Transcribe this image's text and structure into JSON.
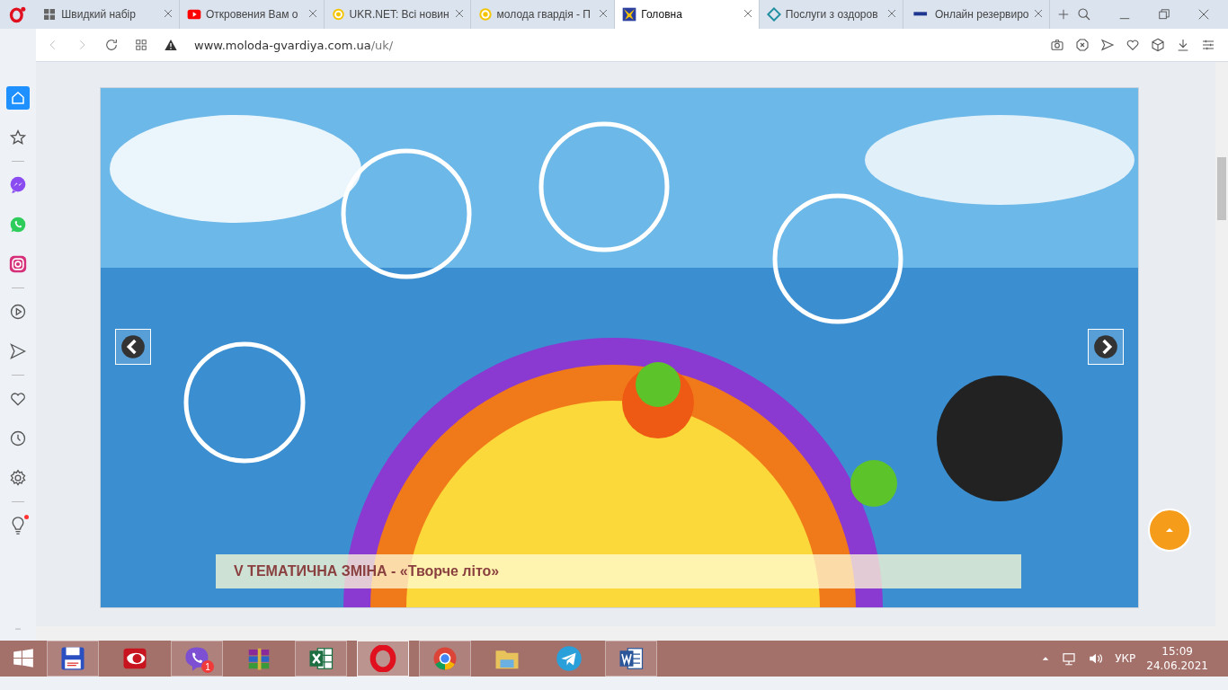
{
  "tabs": [
    {
      "label": "Швидкий набір",
      "kind": "grid",
      "selected": false
    },
    {
      "label": "Откровения Вам о",
      "kind": "video",
      "selected": false
    },
    {
      "label": "UKR.NET: Всі новин",
      "kind": "coin",
      "selected": false
    },
    {
      "label": "молода гвардія - П",
      "kind": "coin",
      "selected": false
    },
    {
      "label": "Головна",
      "kind": "star",
      "selected": true
    },
    {
      "label": "Послуги з оздоров",
      "kind": "diamond",
      "selected": false
    },
    {
      "label": "Онлайн резервиро",
      "kind": "rail",
      "selected": false
    }
  ],
  "address_bar": {
    "host": "www.moloda-gvardiya.com.ua",
    "path": "/uk/"
  },
  "sidebar": {
    "items": [
      {
        "kind": "home",
        "selected": true,
        "notify": false
      },
      {
        "kind": "star",
        "selected": false,
        "notify": false
      },
      {
        "kind": "sep"
      },
      {
        "kind": "messenger",
        "selected": false,
        "notify": false
      },
      {
        "kind": "whatsapp",
        "selected": false,
        "notify": false
      },
      {
        "kind": "instagram",
        "selected": false,
        "notify": false
      },
      {
        "kind": "sep"
      },
      {
        "kind": "player",
        "selected": false,
        "notify": false
      },
      {
        "kind": "send",
        "selected": false,
        "notify": false
      },
      {
        "kind": "sep"
      },
      {
        "kind": "heart",
        "selected": false,
        "notify": false
      },
      {
        "kind": "clock",
        "selected": false,
        "notify": false
      },
      {
        "kind": "gear",
        "selected": false,
        "notify": false
      },
      {
        "kind": "sep"
      },
      {
        "kind": "bulb",
        "selected": false,
        "notify": true
      }
    ]
  },
  "slider": {
    "caption": "V ТЕМАТИЧНА ЗМІНА - «Творче літо»"
  },
  "taskbar": {
    "apps": [
      {
        "kind": "save",
        "open": true,
        "selected": false
      },
      {
        "kind": "eye",
        "open": false,
        "selected": false
      },
      {
        "kind": "viber",
        "open": true,
        "selected": false,
        "badge": "1"
      },
      {
        "kind": "books",
        "open": false,
        "selected": false
      },
      {
        "kind": "sheet",
        "open": true,
        "selected": false
      },
      {
        "kind": "opera",
        "open": true,
        "selected": true
      },
      {
        "kind": "chrome",
        "open": true,
        "selected": false
      },
      {
        "kind": "folder",
        "open": false,
        "selected": false
      },
      {
        "kind": "plane",
        "open": false,
        "selected": false
      },
      {
        "kind": "doc",
        "open": true,
        "selected": false
      }
    ],
    "language": "УКР",
    "time": "15:09",
    "date": "24.06.2021"
  }
}
